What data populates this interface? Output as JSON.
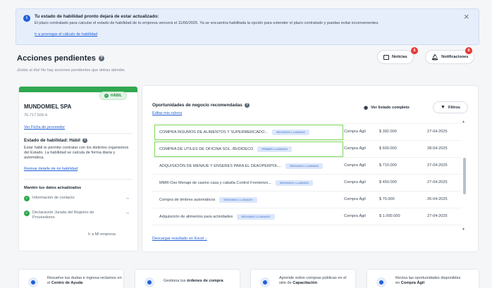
{
  "alert": {
    "title": "Tu estado de habilidad pronto dejará de estar actualizado:",
    "body": "El plazo contratado para calcular el estado de habilidad de tu empresa vencerá el 11/06/2025. Ya se encuentra habilitada la opción para extender el plazo contratado y puedas evitar inconvenientes.",
    "link": "Ir a prorrogar el cálculo de habilidad",
    "close": "×",
    "icon": "info-icon"
  },
  "header": {
    "title": "Acciones pendientes",
    "subtitle": "¡Estás al día! No hay acciones pendientes que debas atender.",
    "noticias": {
      "label": "Noticias",
      "badge": "6"
    },
    "notificaciones": {
      "label": "Notificaciones",
      "badge": "6"
    }
  },
  "left_card": {
    "status": "HÁBIL",
    "company": "MUNDOMIEL SPA",
    "rut": "76.717.509-4",
    "provider_link": "Ver Ficha de proveedor",
    "estado_title": "Estado de habilidad: Hábil",
    "estado_desc": "Estar hábil te permite contratar con los distintos organismos del Estado. La habilidad se calcula de forma diaria y automática.",
    "detalle_link": "Revisar detalle de mi habilidad",
    "mantener_title": "Mantén tus datos actualizados",
    "items": [
      {
        "label": "Información de contacto"
      },
      {
        "label": "Declaración Jurada del Registro de Proveedores"
      }
    ],
    "mi_empresa": "Ir a Mi empresa"
  },
  "opportunities": {
    "title": "Oportunidades de negocio recomendadas",
    "edit_link": "Editar mis rubros",
    "listado_btn": "Ver listado completo",
    "filtros_btn": "Filtros",
    "excel_link": "Descargar resultado en Excel",
    "rows": [
      {
        "name": "COMPRA INSUMOS DE ALIMENTOS Y SUPERMERCADO...",
        "tag": "SEGUNDO LLAMADO",
        "type": "Compra Ágil",
        "amount": "$ 392.000",
        "date": "27-04-2025",
        "highlight": true
      },
      {
        "name": "COMPRA DE UTILES DE OFICINA SOL. 85/DIDECO",
        "tag": "PRIMER LLAMADO",
        "type": "Compra Ágil",
        "amount": "$ 600.000",
        "date": "28-04-2025",
        "highlight": true
      },
      {
        "name": "ADQUISICIÓN DE MENAJE Y ENSERES PARA EL DEAOPERPOL...",
        "tag": "SEGUNDO LLAMADO",
        "type": "Compra Ágil",
        "amount": "$ 710.000",
        "date": "27-04-2025",
        "highlight": false
      },
      {
        "name": "MMR-Oso Menaje de casino casa y caballa Control Fronterizo...",
        "tag": "SEGUNDO LLAMADO",
        "type": "Compra Ágil",
        "amount": "$ 450.000",
        "date": "27-04-2025",
        "highlight": false
      },
      {
        "name": "Compra de timbres automáticos",
        "tag": "SEGUNDO LLAMADO",
        "type": "Compra Ágil",
        "amount": "$ 70.000",
        "date": "26-04-2025",
        "highlight": false
      },
      {
        "name": "Adquisición de alimentos para actividades",
        "tag": "SEGUNDO LLAMADO",
        "type": "Compra Ágil",
        "amount": "$ 1.000.000",
        "date": "27-04-2025",
        "highlight": false
      }
    ]
  },
  "bottom_cards": [
    {
      "text": "Resuelve tus dudas e ingresa reclamos en el ",
      "bold": "Centro de Ayuda"
    },
    {
      "text": "Gestiona tus ",
      "bold": "órdenes de compra"
    },
    {
      "text": "Aprende sobre compras públicas en el sitio de ",
      "bold": "Capacitación"
    },
    {
      "text": "Revisa las oportunidades disponibles en ",
      "bold": "Compra Ágil"
    }
  ]
}
